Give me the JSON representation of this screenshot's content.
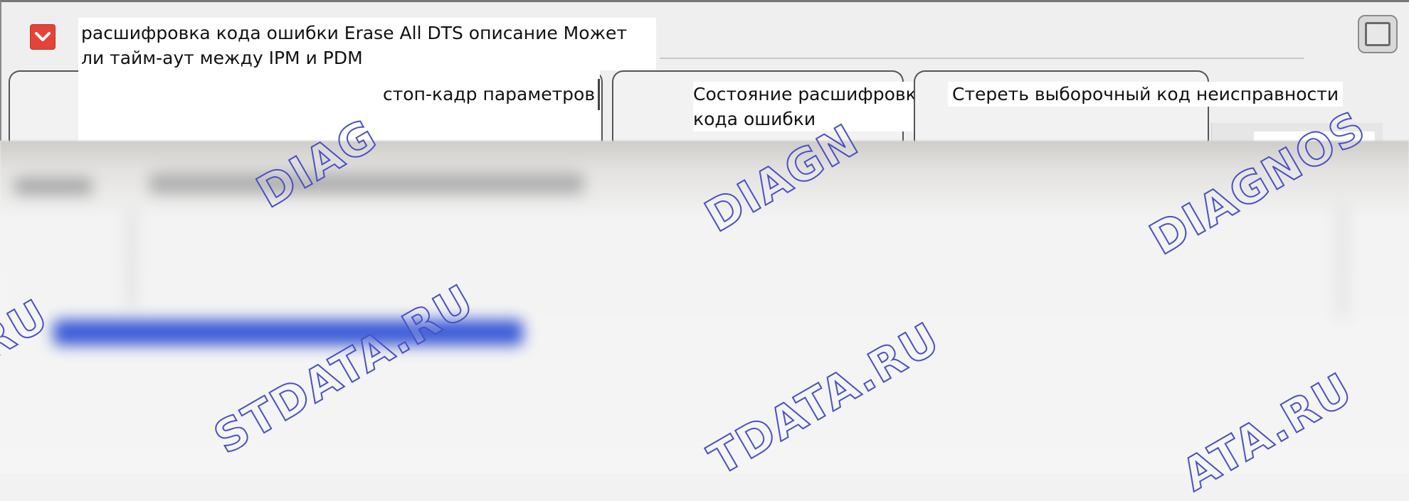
{
  "window": {
    "title": "расшифровка кода ошибки Erase All DTS описание Может ли тайм-аут между IPM и PDM"
  },
  "tabs": [
    {
      "label": "стоп-кадр параметров"
    },
    {
      "label": "Состояние расшифровка кода ошибки"
    },
    {
      "label": "Стереть выборочный код неисправности"
    }
  ],
  "watermarks": {
    "top": [
      "DIAG",
      "DIAGN",
      "DIAGNOS"
    ],
    "bottom": [
      "RU",
      "STDATA.RU",
      "TDATA.RU",
      "ATA.RU"
    ]
  },
  "colors": {
    "app_icon": "#e2443a",
    "watermark_stroke": "#4a4fc4",
    "blurred_link": "#3b5bd6"
  },
  "icons": {
    "app": "app-menu-icon",
    "window_button": "maximize-icon"
  }
}
